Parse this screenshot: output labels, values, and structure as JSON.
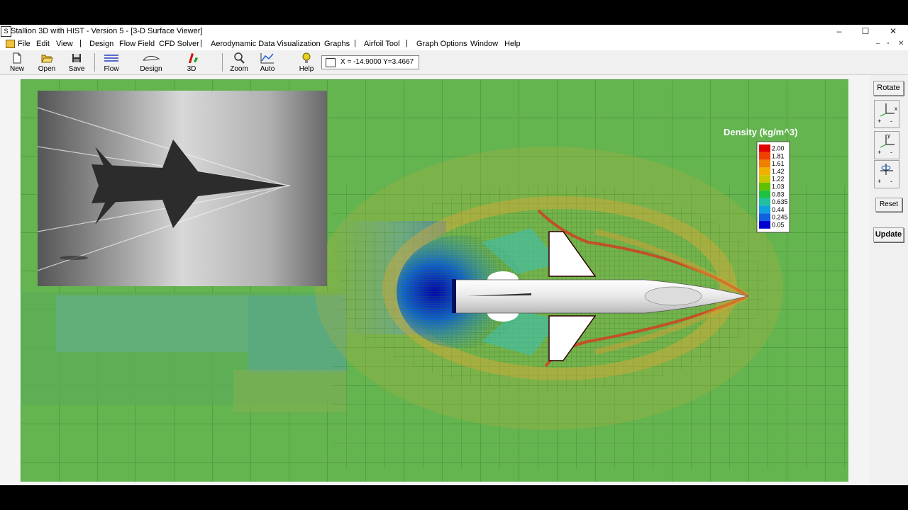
{
  "window": {
    "app_icon": "stallion-app-icon",
    "title": "Stallion 3D with HIST - Version 5 - [3-D Surface Viewer]",
    "controls": [
      "–",
      "☐",
      "✕"
    ]
  },
  "menu": {
    "items": [
      "File",
      "Edit",
      "View",
      "Design",
      "Flow Field",
      "CFD Solver",
      "Aerodynamic Data",
      "Visualization",
      "Graphs",
      "Airfoil Tool",
      "Graph Options",
      "Window",
      "Help"
    ],
    "separators": [
      "|",
      "|",
      "|",
      "|"
    ],
    "mdi_controls": [
      "–",
      "▫",
      "✕"
    ]
  },
  "toolbar": {
    "new": "New",
    "open": "Open",
    "save": "Save",
    "flow": "Flow",
    "design": "Design",
    "three_d": "3D",
    "zoom": "Zoom",
    "auto": "Auto",
    "help": "Help",
    "coords": "X = -14.9000  Y=3.4667"
  },
  "legend": {
    "title": "Density (kg/m^3)",
    "values": [
      "2.00",
      "1.81",
      "1.61",
      "1.42",
      "1.22",
      "1.03",
      "0.83",
      "0.635",
      "0.44",
      "0.245",
      "0.05"
    ],
    "colors": [
      "#e00000",
      "#f04000",
      "#f08000",
      "#f0b000",
      "#c8c800",
      "#60c000",
      "#20c040",
      "#20c0a0",
      "#10a0e0",
      "#1060e0",
      "#0000d0"
    ]
  },
  "side_panel": {
    "rotate": "Rotate",
    "axis_x": "x",
    "axis_y": "y",
    "plus": "+",
    "minus": "-",
    "reset": "Reset",
    "update": "Update"
  }
}
